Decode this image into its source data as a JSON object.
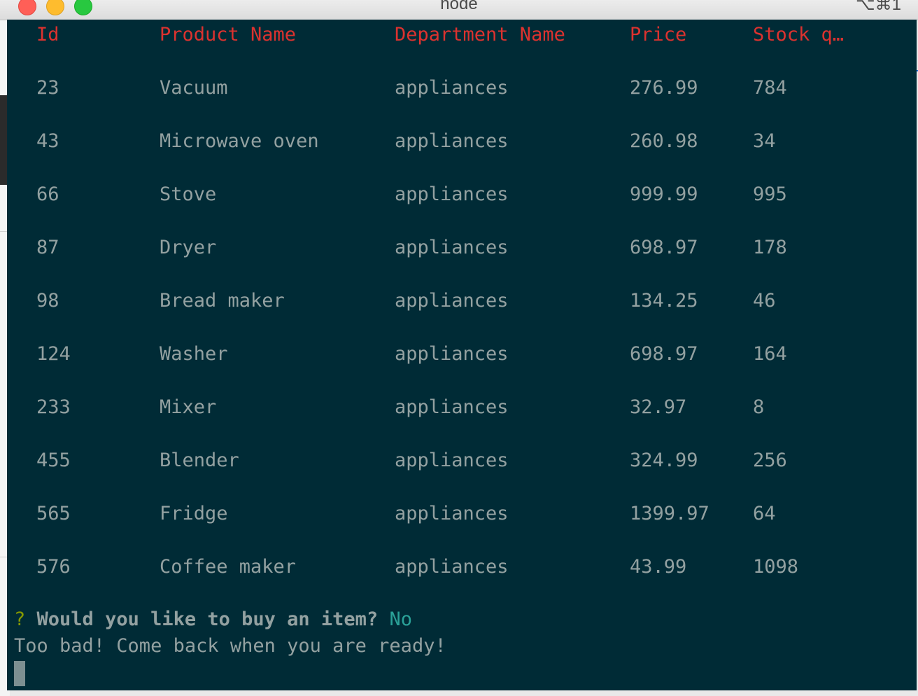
{
  "window": {
    "title": "node",
    "shortcut": "⌥⌘1"
  },
  "table": {
    "headers": {
      "id": "Id",
      "product_name": "Product Name",
      "department_name": "Department Name",
      "price": "Price",
      "stock": "Stock q…"
    },
    "rows": [
      {
        "id": "23",
        "product_name": "Vacuum",
        "department_name": "appliances",
        "price": "276.99",
        "stock": "784"
      },
      {
        "id": "43",
        "product_name": "Microwave oven",
        "department_name": "appliances",
        "price": "260.98",
        "stock": "34"
      },
      {
        "id": "66",
        "product_name": "Stove",
        "department_name": "appliances",
        "price": "999.99",
        "stock": "995"
      },
      {
        "id": "87",
        "product_name": "Dryer",
        "department_name": "appliances",
        "price": "698.97",
        "stock": "178"
      },
      {
        "id": "98",
        "product_name": "Bread maker",
        "department_name": "appliances",
        "price": "134.25",
        "stock": "46"
      },
      {
        "id": "124",
        "product_name": "Washer",
        "department_name": "appliances",
        "price": "698.97",
        "stock": "164"
      },
      {
        "id": "233",
        "product_name": "Mixer",
        "department_name": "appliances",
        "price": "32.97",
        "stock": "8"
      },
      {
        "id": "455",
        "product_name": "Blender",
        "department_name": "appliances",
        "price": "324.99",
        "stock": "256"
      },
      {
        "id": "565",
        "product_name": "Fridge",
        "department_name": "appliances",
        "price": "1399.97",
        "stock": "64"
      },
      {
        "id": "576",
        "product_name": "Coffee maker",
        "department_name": "appliances",
        "price": "43.99",
        "stock": "1098"
      }
    ]
  },
  "prompt": {
    "mark": "?",
    "question": "Would you like to buy an item?",
    "answer": "No"
  },
  "message": "Too bad! Come back when you are ready!",
  "colors": {
    "background": "#002b36",
    "header": "#dc322f",
    "text": "#93a1a1",
    "prompt_mark": "#859900",
    "answer": "#2aa198"
  }
}
